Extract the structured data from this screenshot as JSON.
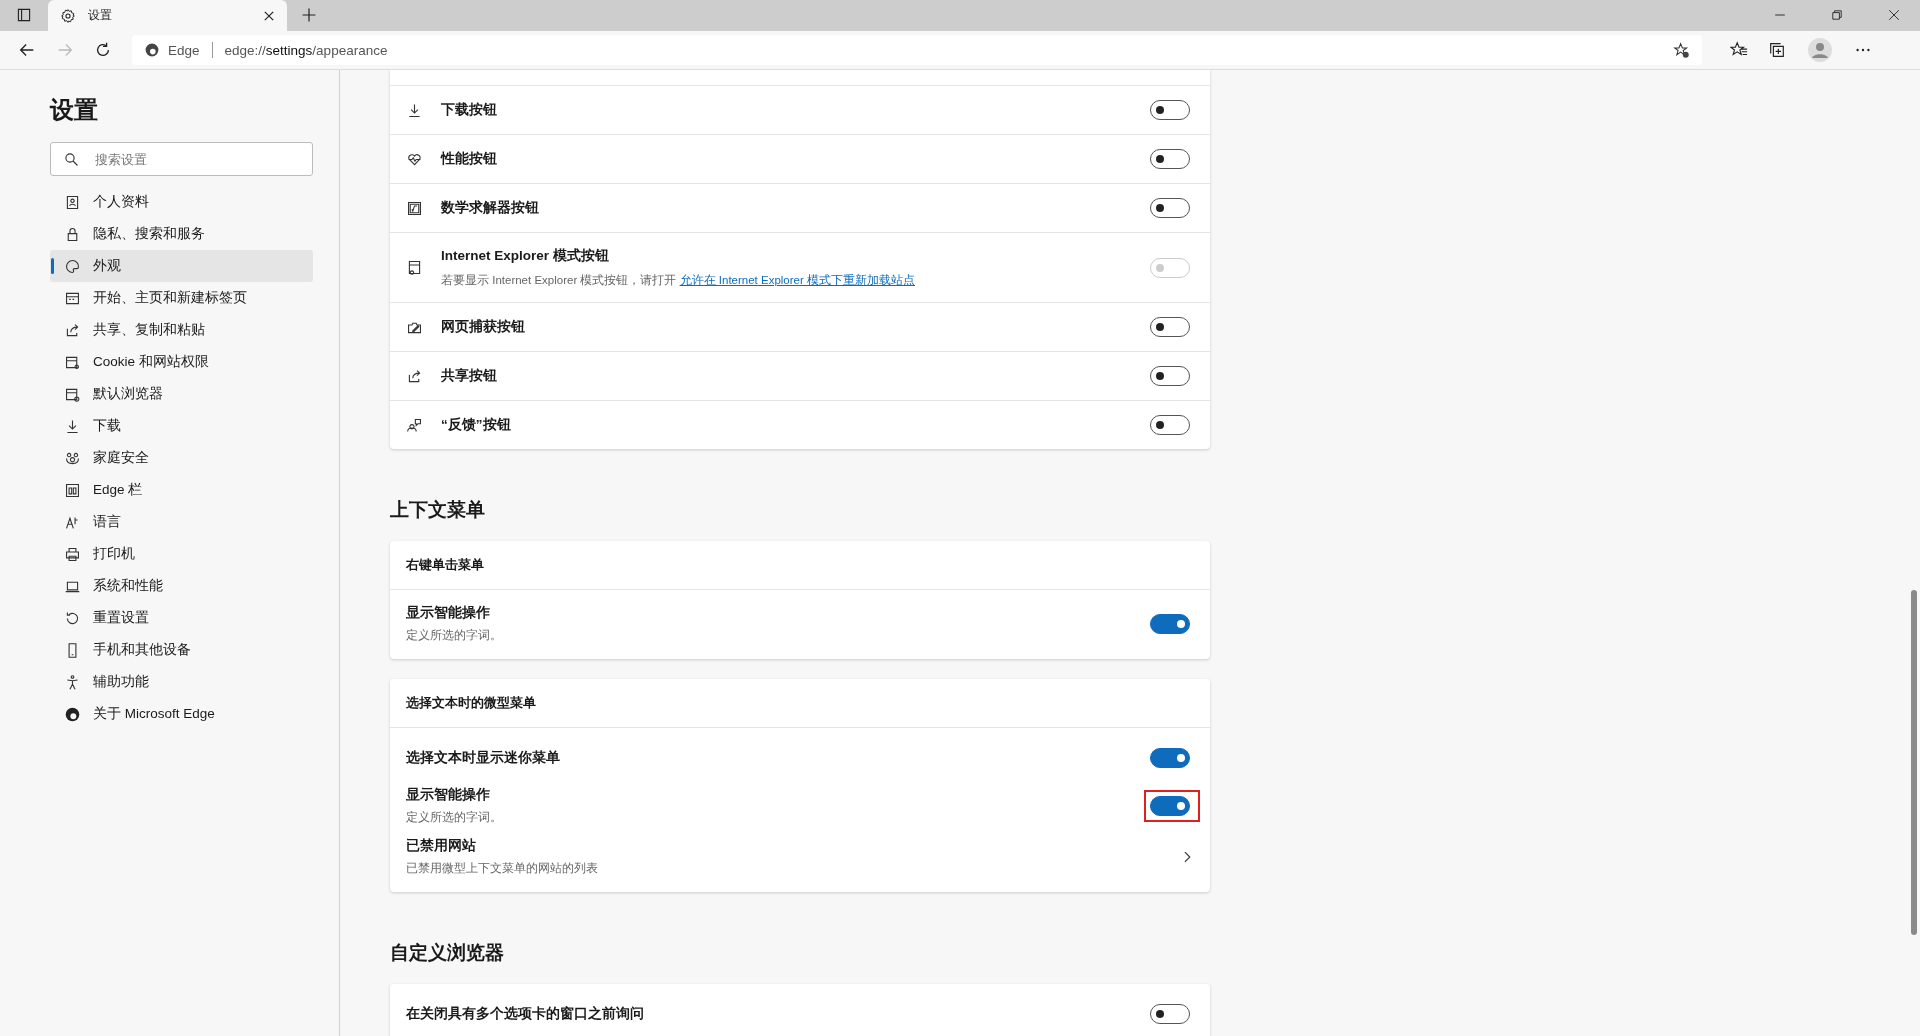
{
  "browser": {
    "tab_title": "设置",
    "site_label": "Edge",
    "url_scheme": "edge://",
    "url_host": "settings",
    "url_path": "/appearance"
  },
  "sidebar": {
    "title": "设置",
    "search": {
      "placeholder": "搜索设置"
    },
    "items": [
      {
        "label": "个人资料",
        "selected": false
      },
      {
        "label": "隐私、搜索和服务",
        "selected": false
      },
      {
        "label": "外观",
        "selected": true
      },
      {
        "label": "开始、主页和新建标签页",
        "selected": false
      },
      {
        "label": "共享、复制和粘贴",
        "selected": false
      },
      {
        "label": "Cookie 和网站权限",
        "selected": false
      },
      {
        "label": "默认浏览器",
        "selected": false
      },
      {
        "label": "下载",
        "selected": false
      },
      {
        "label": "家庭安全",
        "selected": false
      },
      {
        "label": "Edge 栏",
        "selected": false
      },
      {
        "label": "语言",
        "selected": false
      },
      {
        "label": "打印机",
        "selected": false
      },
      {
        "label": "系统和性能",
        "selected": false
      },
      {
        "label": "重置设置",
        "selected": false
      },
      {
        "label": "手机和其他设备",
        "selected": false
      },
      {
        "label": "辅助功能",
        "selected": false
      },
      {
        "label": "关于 Microsoft Edge",
        "selected": false
      }
    ]
  },
  "blocks": [
    {
      "kind": "card",
      "rows": [
        {
          "kind": "toggle",
          "title": "下载按钮",
          "on": false,
          "disabled": false,
          "highlighted": false
        },
        {
          "kind": "toggle",
          "title": "性能按钮",
          "on": false,
          "disabled": false,
          "highlighted": false
        },
        {
          "kind": "toggle",
          "title": "数学求解器按钮",
          "on": false,
          "disabled": false,
          "highlighted": false
        },
        {
          "kind": "toggle",
          "title": "Internet Explorer 模式按钮",
          "description": "若要显示 Internet Explorer 模式按钮，请打开 ",
          "link": "允许在 Internet Explorer 模式下重新加载站点",
          "on": false,
          "disabled": true,
          "highlighted": false
        },
        {
          "kind": "toggle",
          "title": "网页捕获按钮",
          "on": false,
          "disabled": false,
          "highlighted": false
        },
        {
          "kind": "toggle",
          "title": "共享按钮",
          "on": false,
          "disabled": false,
          "highlighted": false
        },
        {
          "kind": "toggle",
          "title": "“反馈”按钮",
          "on": false,
          "disabled": false,
          "highlighted": false
        }
      ]
    },
    {
      "kind": "heading",
      "text": "上下文菜单"
    },
    {
      "kind": "card",
      "header": "右键单击菜单",
      "rows": [
        {
          "kind": "toggle",
          "title": "显示智能操作",
          "description": "定义所选的字词。",
          "on": true,
          "disabled": false,
          "highlighted": false
        }
      ]
    },
    {
      "kind": "card",
      "header": "选择文本时的微型菜单",
      "rows": [
        {
          "kind": "toggle",
          "title": "选择文本时显示迷你菜单",
          "on": true,
          "disabled": false,
          "highlighted": false
        },
        {
          "kind": "toggle",
          "title": "显示智能操作",
          "description": "定义所选的字词。",
          "on": true,
          "disabled": false,
          "highlighted": true
        },
        {
          "kind": "link",
          "title": "已禁用网站",
          "description": "已禁用微型上下文菜单的网站的列表"
        }
      ]
    },
    {
      "kind": "heading",
      "text": "自定义浏览器"
    },
    {
      "kind": "card",
      "rows": [
        {
          "kind": "toggle",
          "title": "在关闭具有多个选项卡的窗口之前询问",
          "on": false,
          "disabled": false,
          "highlighted": false
        }
      ]
    }
  ]
}
